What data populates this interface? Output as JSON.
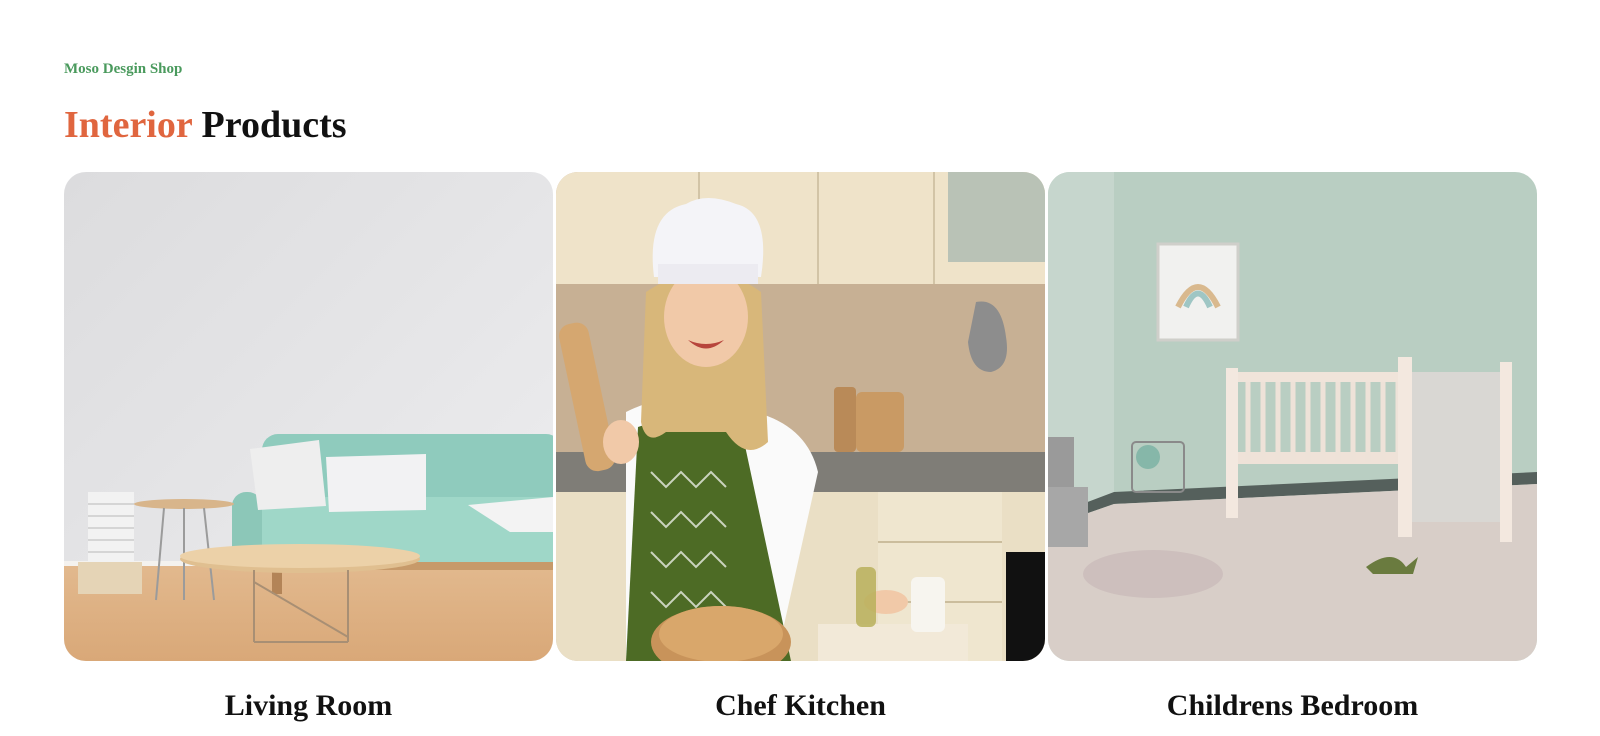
{
  "section": {
    "eyebrow": "Moso Desgin Shop",
    "title_accent": "Interior",
    "title_rest": " Products"
  },
  "colors": {
    "eyebrow": "#4a9a5d",
    "accent": "#e0663f",
    "heading": "#111111"
  },
  "products": [
    {
      "name": "Living Room",
      "image": "living-room-photo"
    },
    {
      "name": "Chef Kitchen",
      "image": "chef-kitchen-photo"
    },
    {
      "name": "Childrens Bedroom",
      "image": "childrens-bedroom-photo"
    }
  ]
}
